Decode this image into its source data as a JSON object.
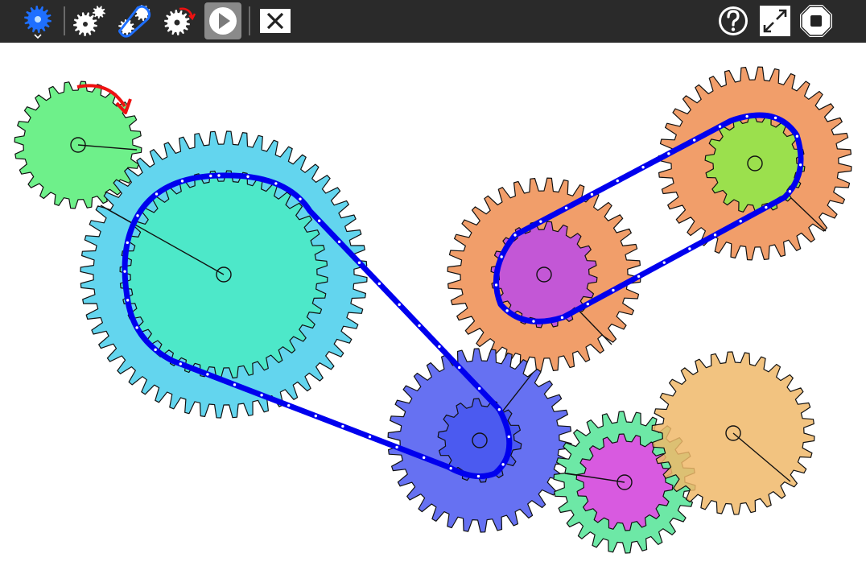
{
  "toolbar": {
    "tools": [
      {
        "name": "gear-tool",
        "icon": "gear-icon",
        "selected": true
      },
      {
        "name": "connected-gears-tool",
        "icon": "connected-gears-icon"
      },
      {
        "name": "chain-tool",
        "icon": "chain-icon"
      },
      {
        "name": "momentum-tool",
        "icon": "momentum-gear-icon"
      }
    ],
    "play": {
      "icon": "play-icon"
    },
    "clear": {
      "icon": "close-icon"
    },
    "help": {
      "icon": "help-icon"
    },
    "fullscreen": {
      "icon": "fullscreen-icon"
    },
    "stop": {
      "icon": "stop-icon"
    },
    "colors": {
      "bar": "#2a2a2a",
      "selected": "#1e6fff",
      "play_bg": "#8a8a8a"
    }
  },
  "scene": {
    "gears": [
      {
        "name": "gear-green-top-left",
        "color": "#6ef08a",
        "driver": true
      },
      {
        "name": "gear-cyan-large",
        "color": "#63d5ee"
      },
      {
        "name": "gear-teal-inner",
        "color": "#4de8c9"
      },
      {
        "name": "gear-orange-middle",
        "color": "#f19e6a"
      },
      {
        "name": "gear-magenta-middle",
        "color": "#c357d6"
      },
      {
        "name": "gear-orange-top-right",
        "color": "#f19e6a"
      },
      {
        "name": "gear-lime-top-right",
        "color": "#9be04d"
      },
      {
        "name": "gear-blue-bottom",
        "color": "#6671f2"
      },
      {
        "name": "gear-blue-bottom-inner",
        "color": "#4b5af0"
      },
      {
        "name": "gear-mint-bottom",
        "color": "#6de8a6"
      },
      {
        "name": "gear-pink-bottom",
        "color": "#d85ae0"
      },
      {
        "name": "gear-gold-bottom-right",
        "color": "#f0b96a"
      }
    ],
    "chain_color": "#0000ee",
    "motor_arrow_color": "#ee1111"
  }
}
